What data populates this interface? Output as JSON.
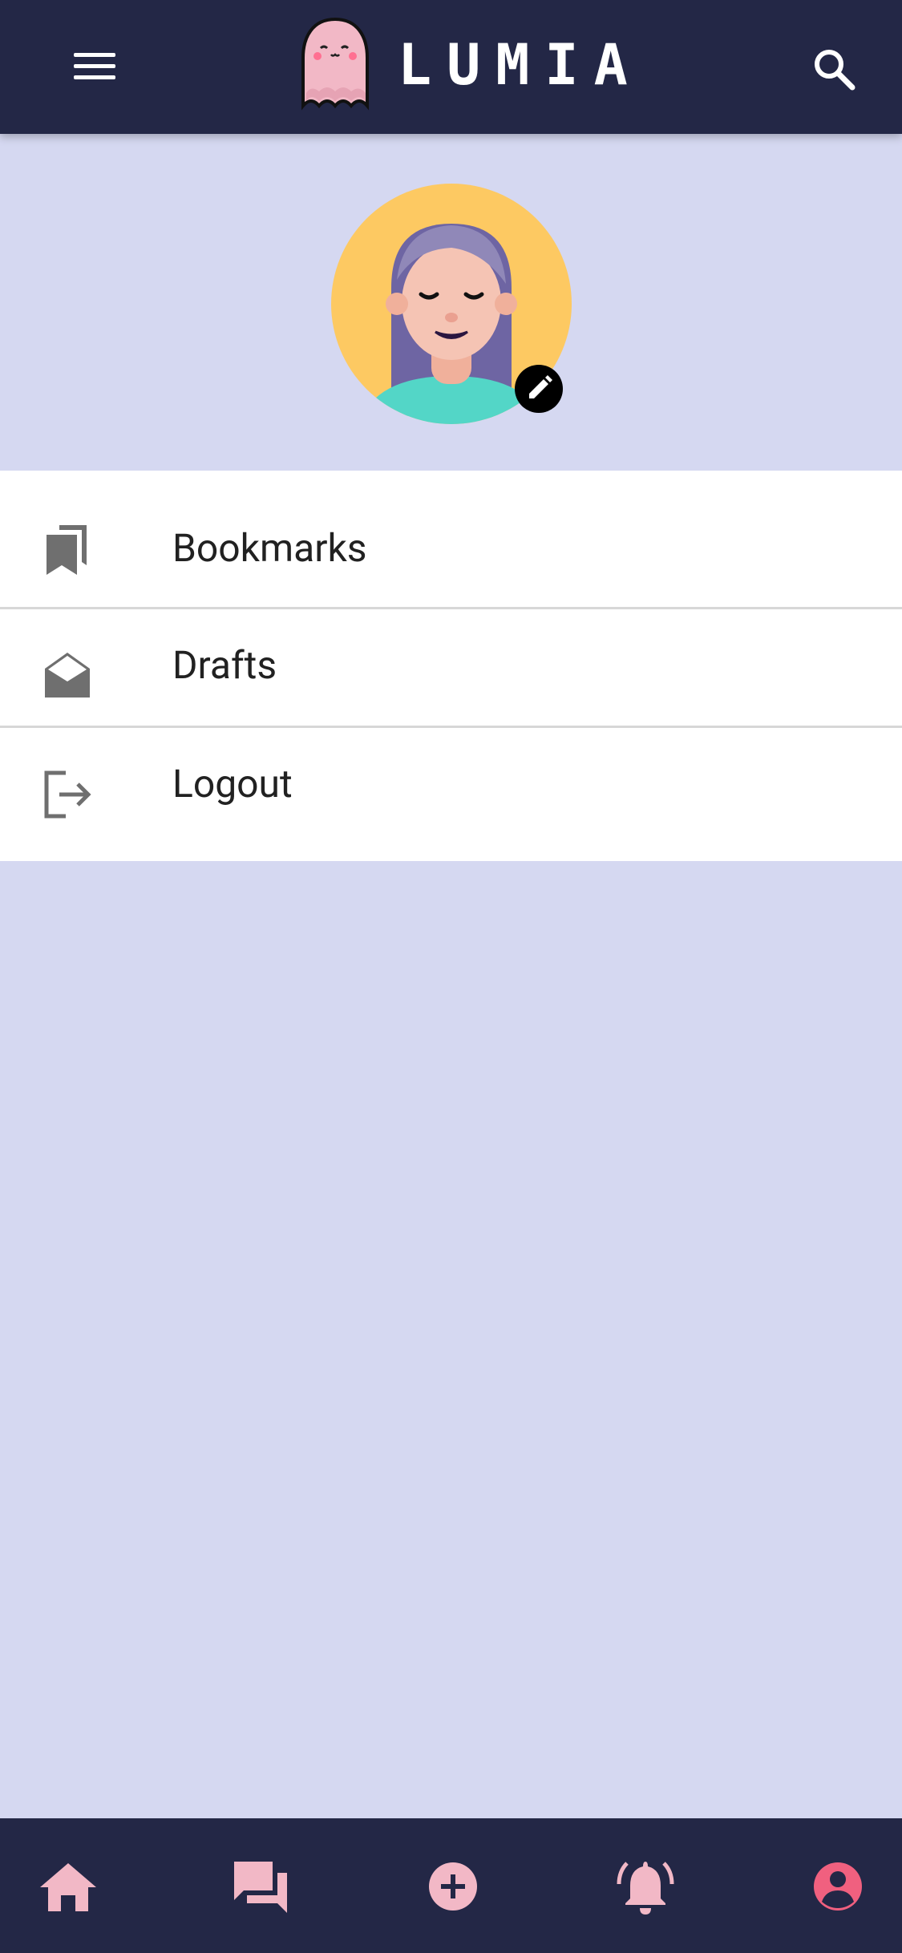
{
  "app": {
    "title": "LUMIA",
    "brand_colors": {
      "bar": "#232746",
      "background": "#d5d8f1",
      "accent_pink": "#f2b8c6",
      "active_pink": "#f0607f"
    }
  },
  "header": {
    "logo_text": "LUMIA",
    "menu_icon": "hamburger-menu-icon",
    "search_icon": "search-icon"
  },
  "profile": {
    "avatar_icon": "user-avatar",
    "edit_icon": "pencil-icon"
  },
  "menu": {
    "items": [
      {
        "label": "Bookmarks",
        "icon": "bookmarks-icon"
      },
      {
        "label": "Drafts",
        "icon": "drafts-envelope-icon"
      },
      {
        "label": "Logout",
        "icon": "logout-icon"
      }
    ]
  },
  "bottom_nav": {
    "items": [
      {
        "icon": "home-icon"
      },
      {
        "icon": "forum-icon"
      },
      {
        "icon": "add-circle-icon"
      },
      {
        "icon": "notifications-active-icon"
      },
      {
        "icon": "account-circle-icon",
        "active": true
      }
    ]
  }
}
